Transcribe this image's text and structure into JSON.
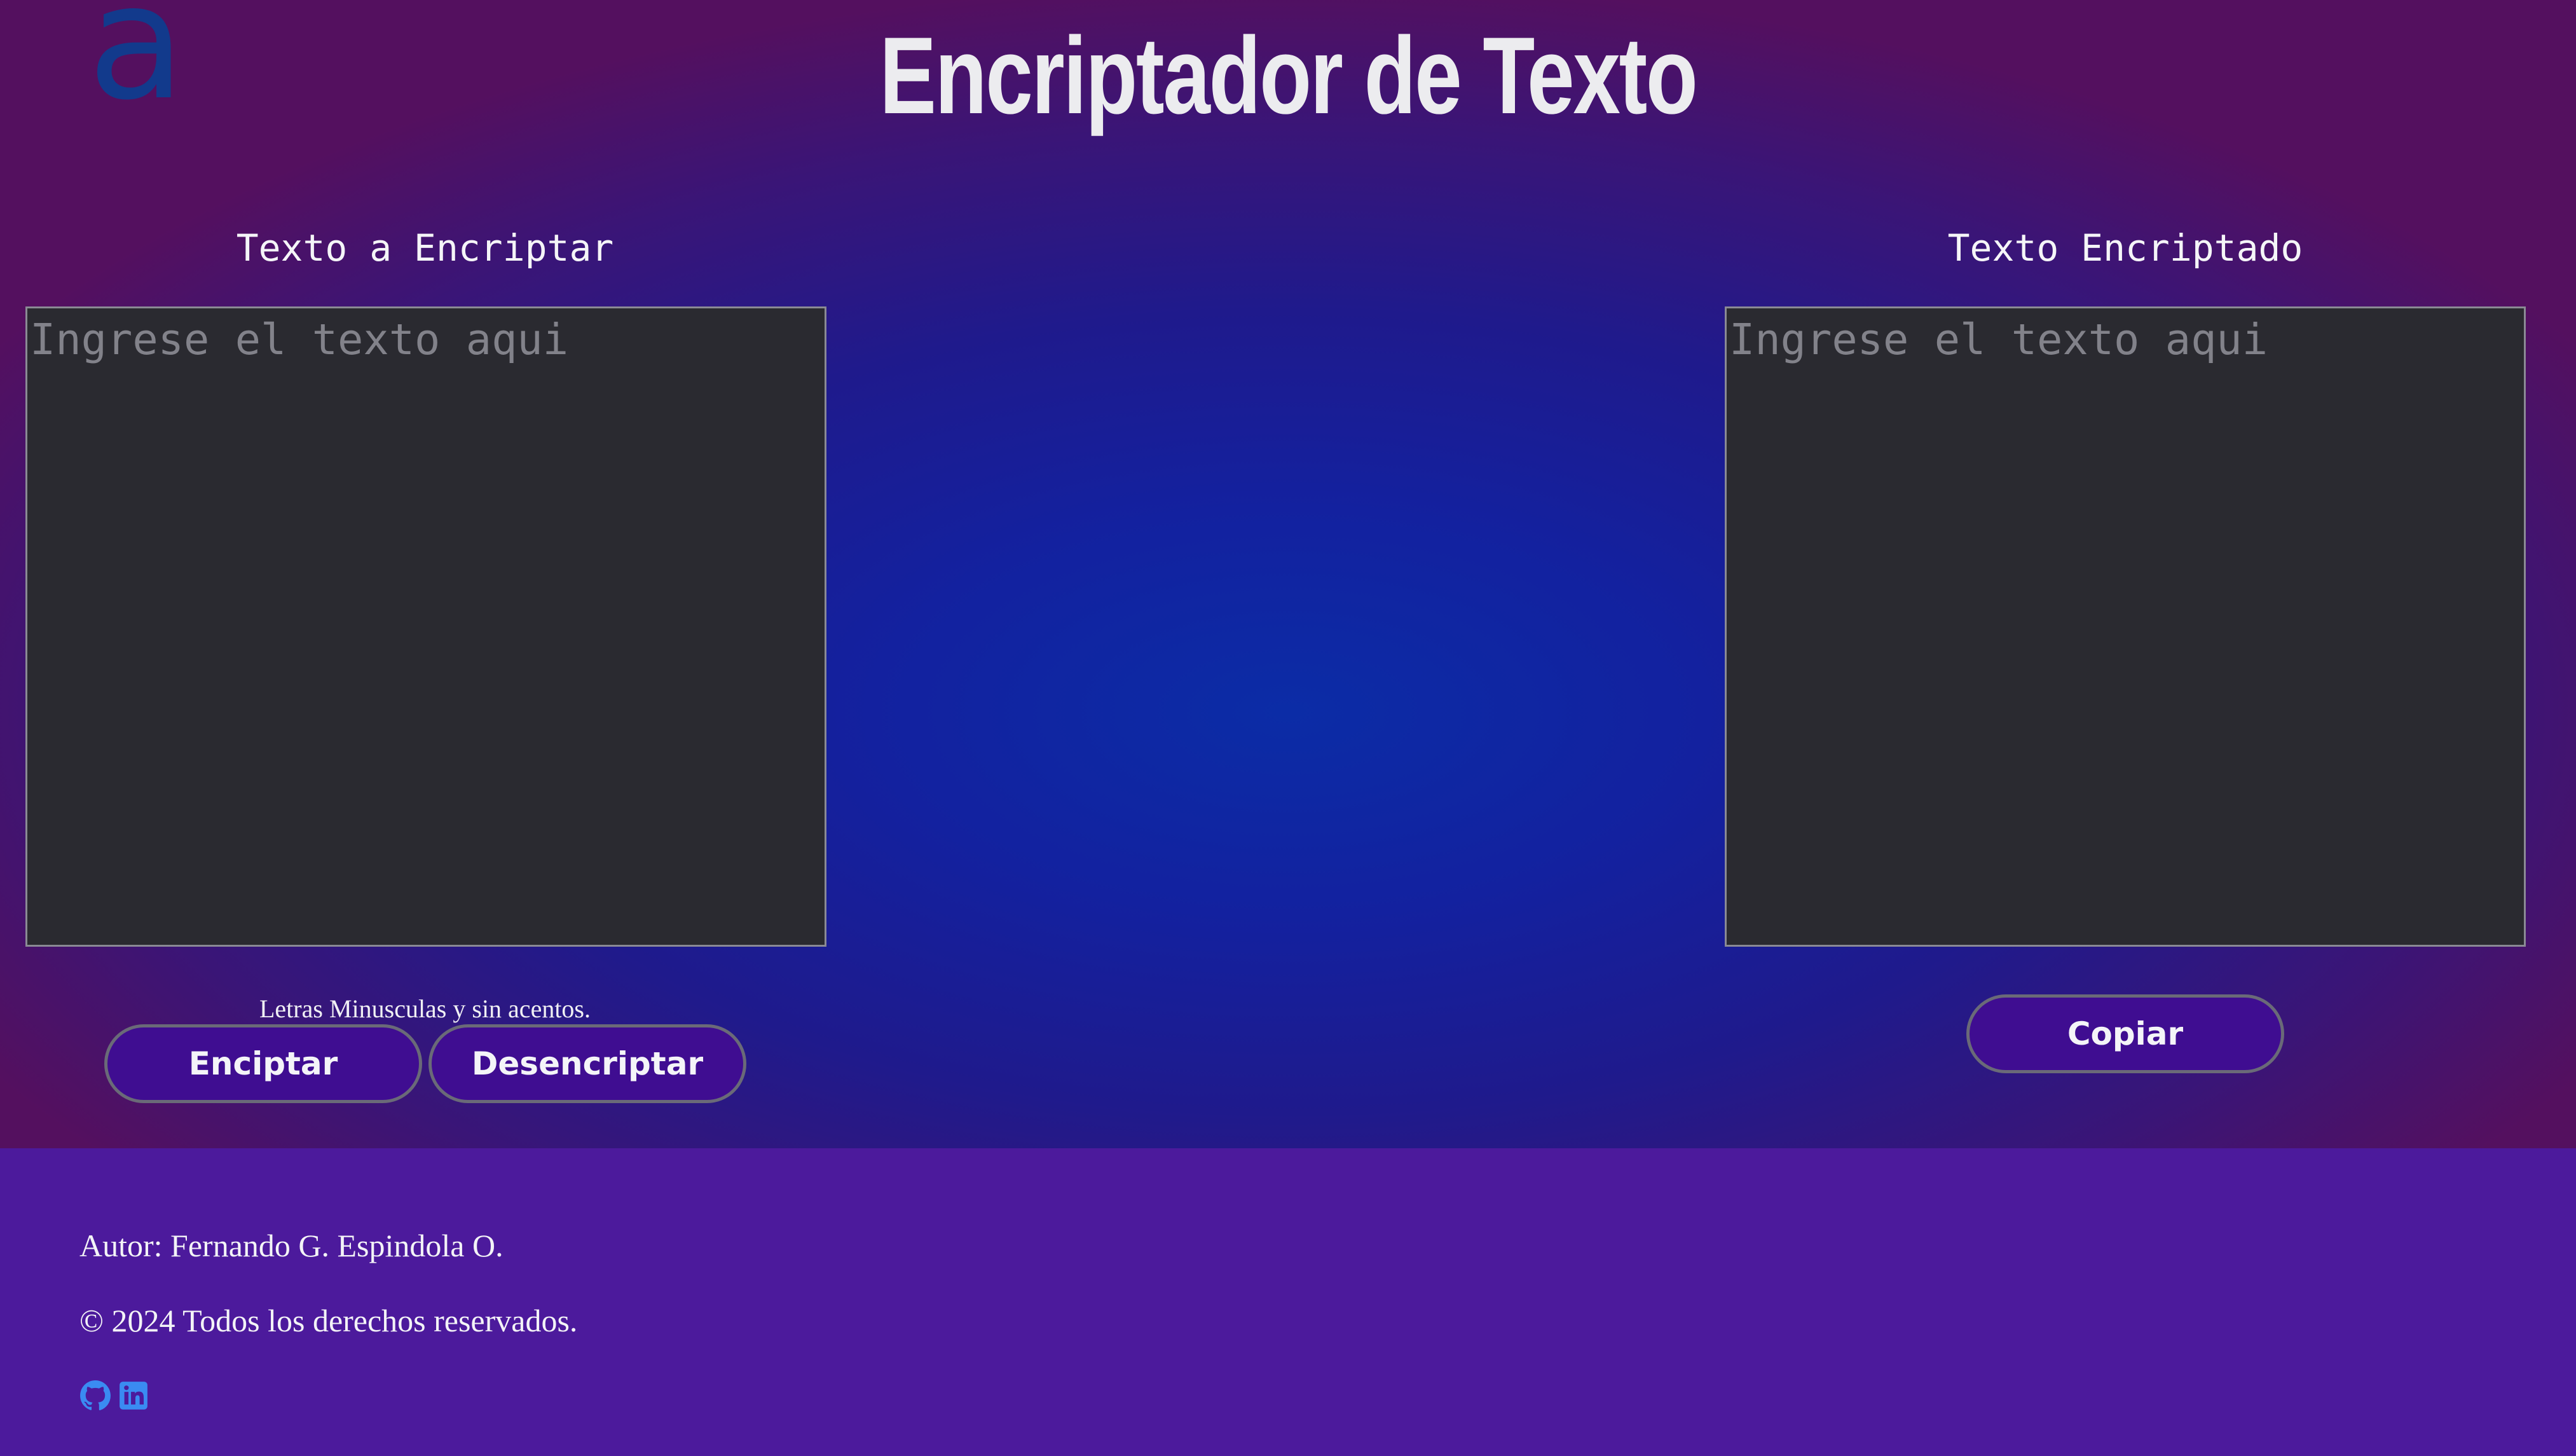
{
  "logo": {
    "text": "a",
    "icon": "logo-a-icon",
    "color": "#123a8c"
  },
  "header": {
    "title": "Encriptador de Texto"
  },
  "input_panel": {
    "title": "Texto a Encriptar",
    "placeholder": "Ingrese el texto aqui",
    "value": "",
    "hint": "Letras Minusculas y sin acentos.",
    "encrypt_label": "Enciptar",
    "decrypt_label": "Desencriptar"
  },
  "output_panel": {
    "title": "Texto Encriptado",
    "placeholder": "Ingrese el texto aqui",
    "value": "",
    "copy_label": "Copiar"
  },
  "footer": {
    "author": "Autor: Fernando G. Espindola O.",
    "copyright": "© 2024 Todos los derechos reservados.",
    "social": [
      {
        "icon": "github-icon"
      },
      {
        "icon": "linkedin-icon"
      }
    ]
  },
  "colors": {
    "background_center": "#0b2ca6",
    "background_edge": "#54105f",
    "footer_background": "#4c1a9c",
    "textarea_background": "#2a2a30",
    "button_background": "#3f0d91",
    "social_icon": "#3a8bf2"
  }
}
